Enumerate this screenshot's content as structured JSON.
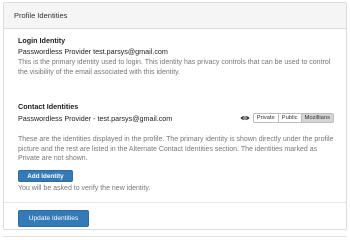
{
  "panel": {
    "title": "Profile Identities"
  },
  "login": {
    "title": "Login Identity",
    "line": "Passwordless Provider test.parsys@gmail.com",
    "desc": "This is the primary identity used to login. This identity has privacy controls that can be used to control the visibility of the email associated with this identity."
  },
  "contact": {
    "title": "Contact Identities",
    "line": "Passwordless Provider - test.parsys@gmail.com",
    "privacy": {
      "icon": "eye-icon",
      "options": [
        "Private",
        "Public",
        "Mozillians"
      ],
      "selected": "Mozillians"
    },
    "desc": "These are the identities displayed in the profile. The primary identity is shown directly under the profile picture and the rest are listed in the Alternate Contact Identities section. The identities marked as Private are not shown.",
    "add_label": "Add Identity",
    "verify_note": "You will be asked to verify the new identity."
  },
  "footer": {
    "update_label": "Update Identities"
  },
  "colors": {
    "primary": "#337ab7",
    "header_bg": "#f5f5f5",
    "selected_option": "#d4d4d4"
  }
}
